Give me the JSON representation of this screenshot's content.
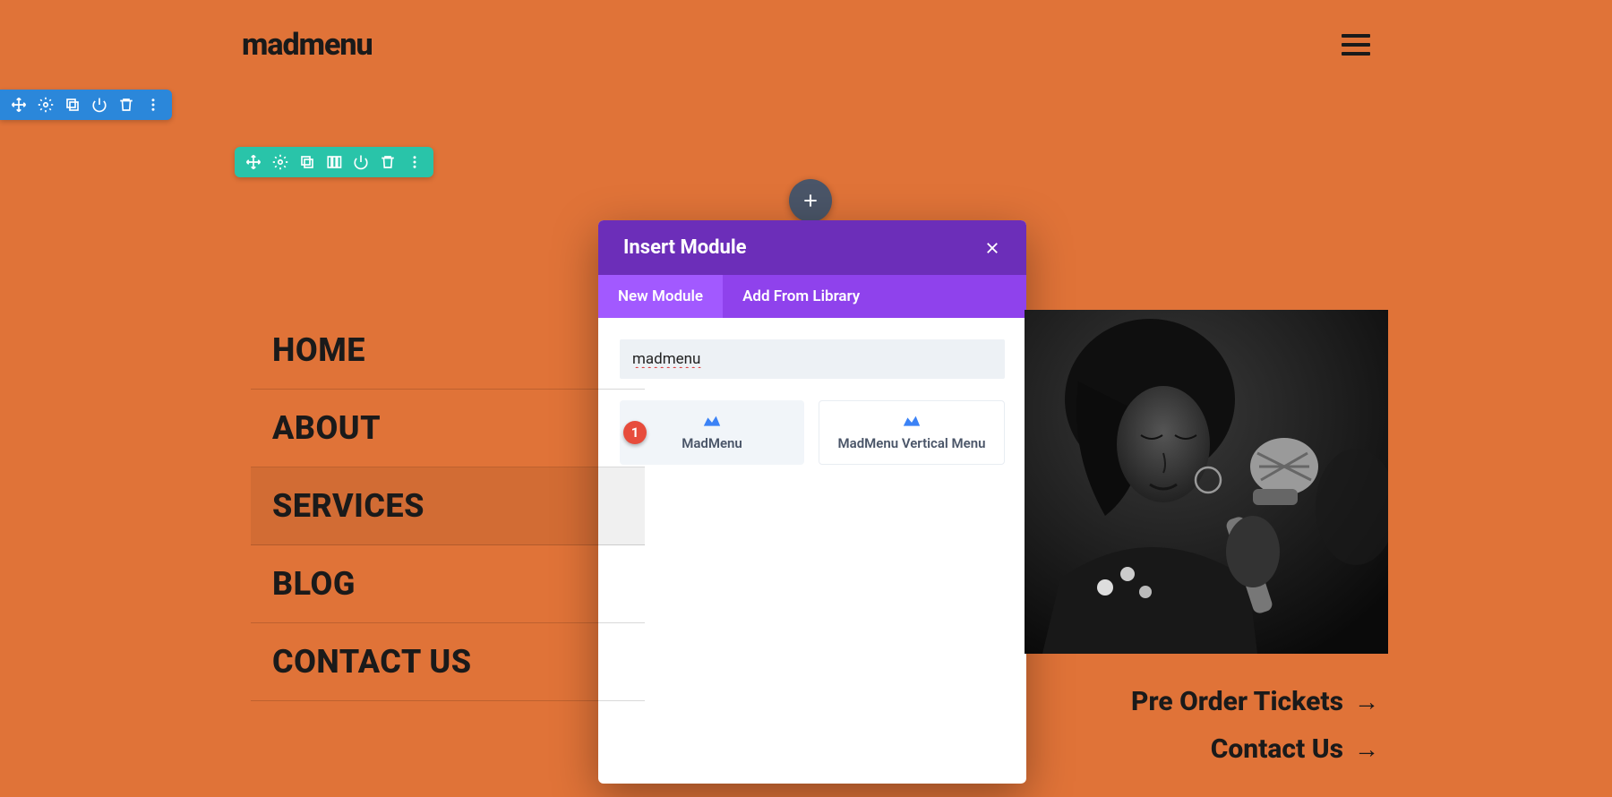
{
  "header": {
    "logo": "madmenu"
  },
  "modal": {
    "title": "Insert Module",
    "tabs": {
      "new": "New Module",
      "library": "Add From Library"
    },
    "search_value": "madmenu",
    "modules": [
      {
        "label": "MadMenu",
        "badge": "1"
      },
      {
        "label": "MadMenu Vertical Menu"
      }
    ]
  },
  "nav": {
    "items": [
      "HOME",
      "ABOUT",
      "SERVICES",
      "BLOG",
      "CONTACT US"
    ],
    "active_index": 2
  },
  "cta": {
    "tickets": "Pre Order Tickets",
    "contact": "Contact Us"
  },
  "colors": {
    "background": "#e07338",
    "modal_header": "#6c2eb9",
    "modal_tab": "#8f42ec",
    "modal_tab_active": "#a259ff",
    "section_toolbar": "#2b87da",
    "row_toolbar": "#29c4a9",
    "badge": "#e74c3c"
  }
}
